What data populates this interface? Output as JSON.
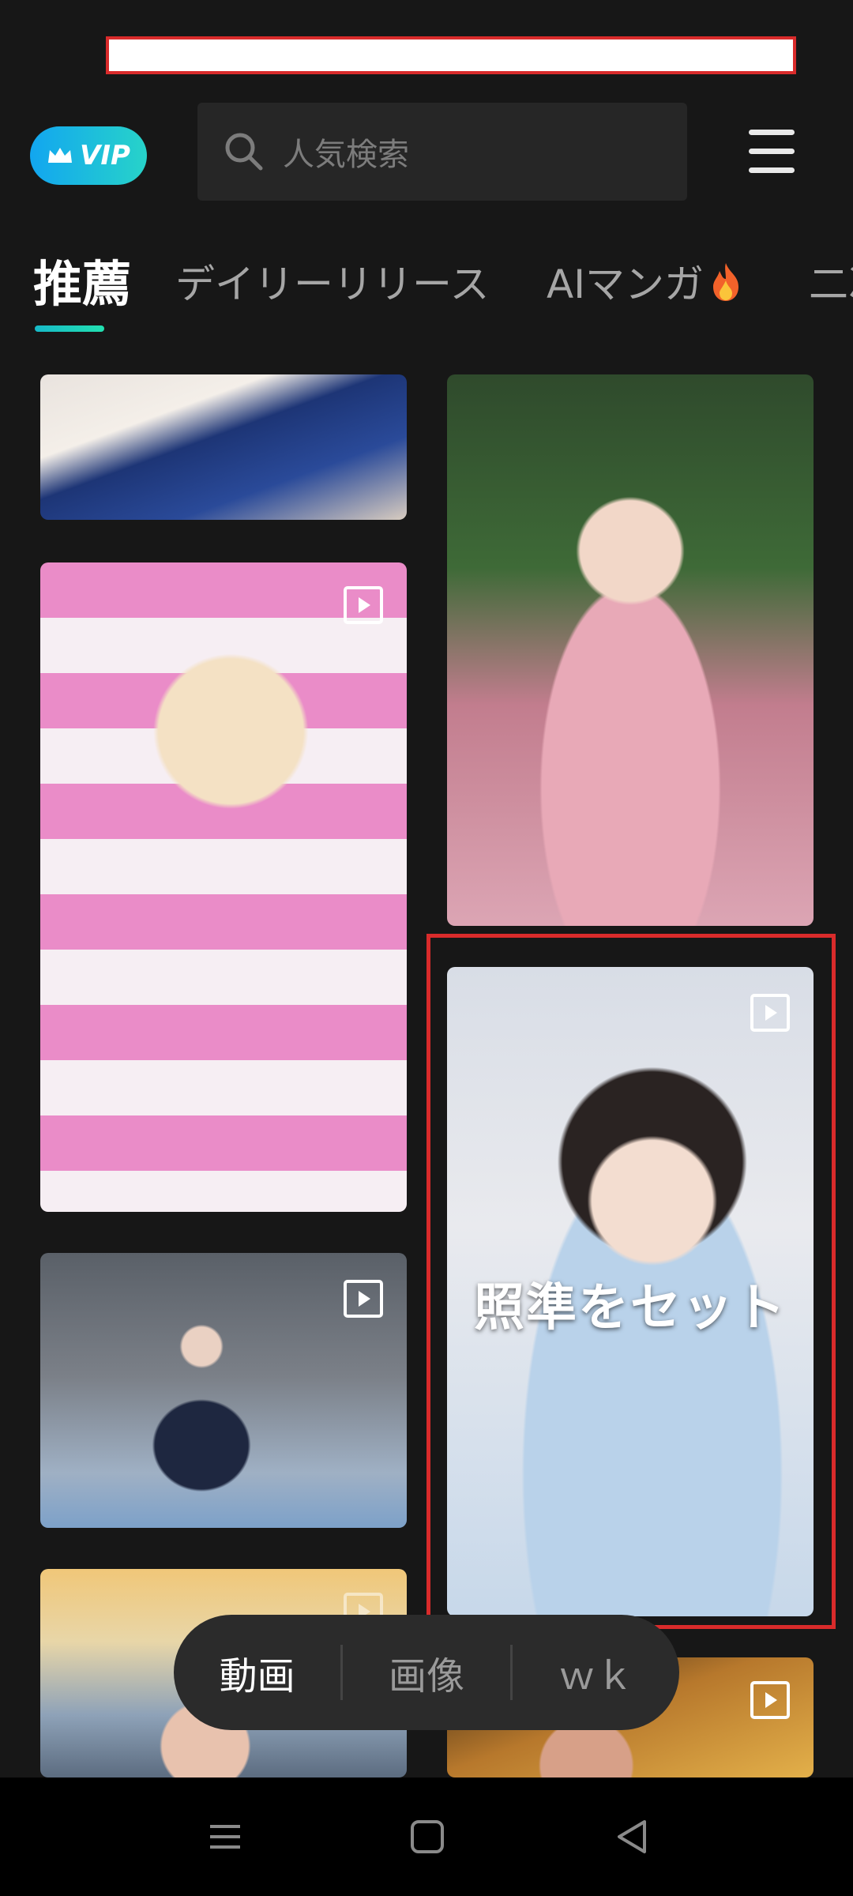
{
  "header": {
    "vip_label": "VIP",
    "search_placeholder": "人気検索"
  },
  "tabs": [
    {
      "label": "推薦",
      "active": true
    },
    {
      "label": "デイリーリリース",
      "active": false
    },
    {
      "label": "AIマンガ",
      "active": false,
      "icon": "fire-icon"
    },
    {
      "label": "二次",
      "active": false
    }
  ],
  "feed": {
    "cards": [
      {
        "id": "card-1",
        "video": false
      },
      {
        "id": "card-2",
        "video": false
      },
      {
        "id": "card-3",
        "video": true
      },
      {
        "id": "card-4",
        "video": true,
        "overlay_text": "照準をセット",
        "highlighted": true
      },
      {
        "id": "card-5",
        "video": true
      },
      {
        "id": "card-6",
        "video": true
      },
      {
        "id": "card-7",
        "video": true
      }
    ]
  },
  "segment": {
    "items": [
      "動画",
      "画像",
      "ｗｋ"
    ],
    "selected": "動画"
  },
  "colors": {
    "background": "#171717",
    "accent": "#22d3b8",
    "vip_gradient_start": "#12a6f0",
    "highlight": "#d92b2b"
  }
}
